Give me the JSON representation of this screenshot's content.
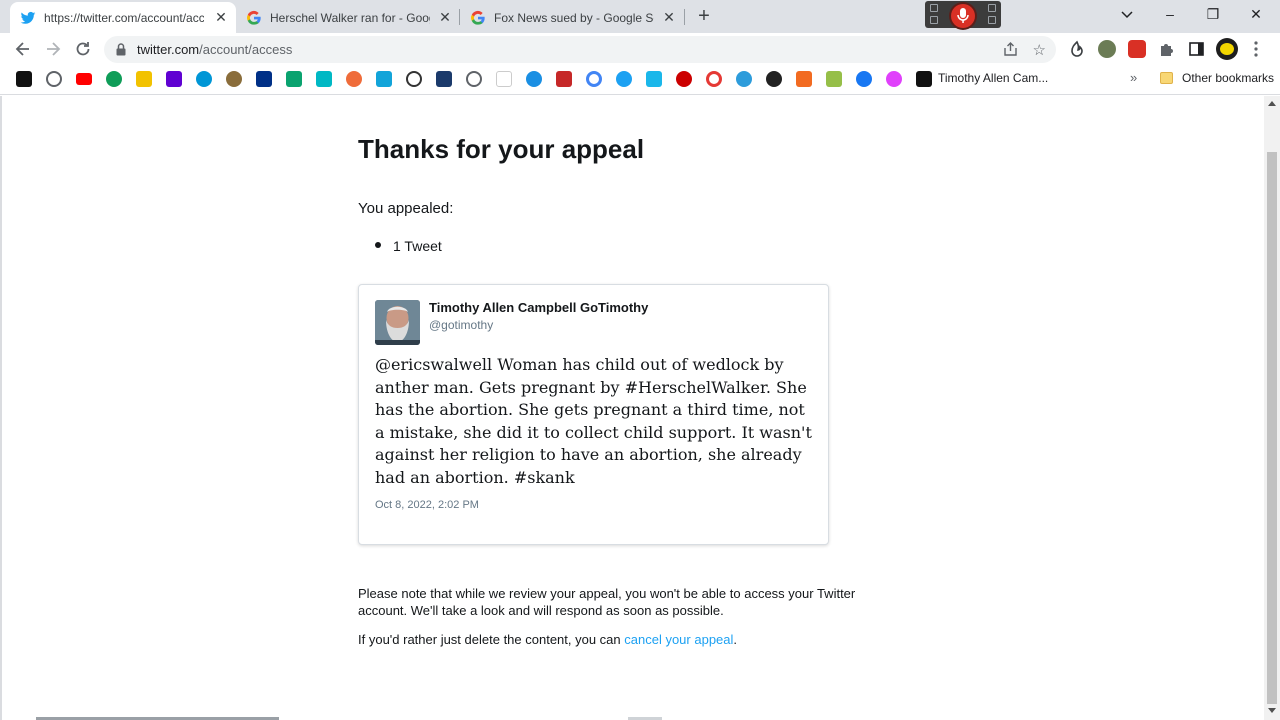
{
  "browser": {
    "tabs": [
      {
        "label": "https://twitter.com/account/acc",
        "favicon": "twitter-bird-icon",
        "active": true
      },
      {
        "label": "Herschel Walker ran for - Google",
        "favicon": "google-g-icon",
        "active": false
      },
      {
        "label": "Fox News sued by - Google Searc",
        "favicon": "google-g-icon",
        "active": false
      }
    ],
    "new_tab_symbol": "+",
    "window_controls": {
      "minimize": "–",
      "restore": "❐",
      "close": "✕"
    },
    "url_host": "twitter.com",
    "url_path": "/account/access",
    "bookmark_labels": {
      "profile_bookmark": "Timothy Allen Cam...",
      "overflow": "»",
      "other_bookmarks": "Other bookmarks"
    },
    "accent_colors": {
      "mic": "#d93025",
      "link": "#1da1f2",
      "twitter": "#1da1f2"
    }
  },
  "page": {
    "title": "Thanks for your appeal",
    "appealed_label": "You appealed:",
    "appealed_items": [
      "1 Tweet"
    ],
    "tweet": {
      "author_name": "Timothy Allen Campbell GoTimothy",
      "author_handle": "@gotimothy",
      "text": "@ericswalwell Woman has child out of wedlock by anther man. Gets pregnant by #HerschelWalker. She has the abortion. She gets pregnant a third time, not a mistake, she did it to collect child support. It wasn't against her religion to have an abortion, she already had an abortion. #skank",
      "timestamp": "Oct 8, 2022, 2:02 PM"
    },
    "note": "Please note that while we review your appeal, you won't be able to access your Twitter account. We'll take a look and will respond as soon as possible.",
    "cancel_prefix": "If you'd rather just delete the content, you can ",
    "cancel_link": "cancel your appeal",
    "cancel_suffix": "."
  }
}
